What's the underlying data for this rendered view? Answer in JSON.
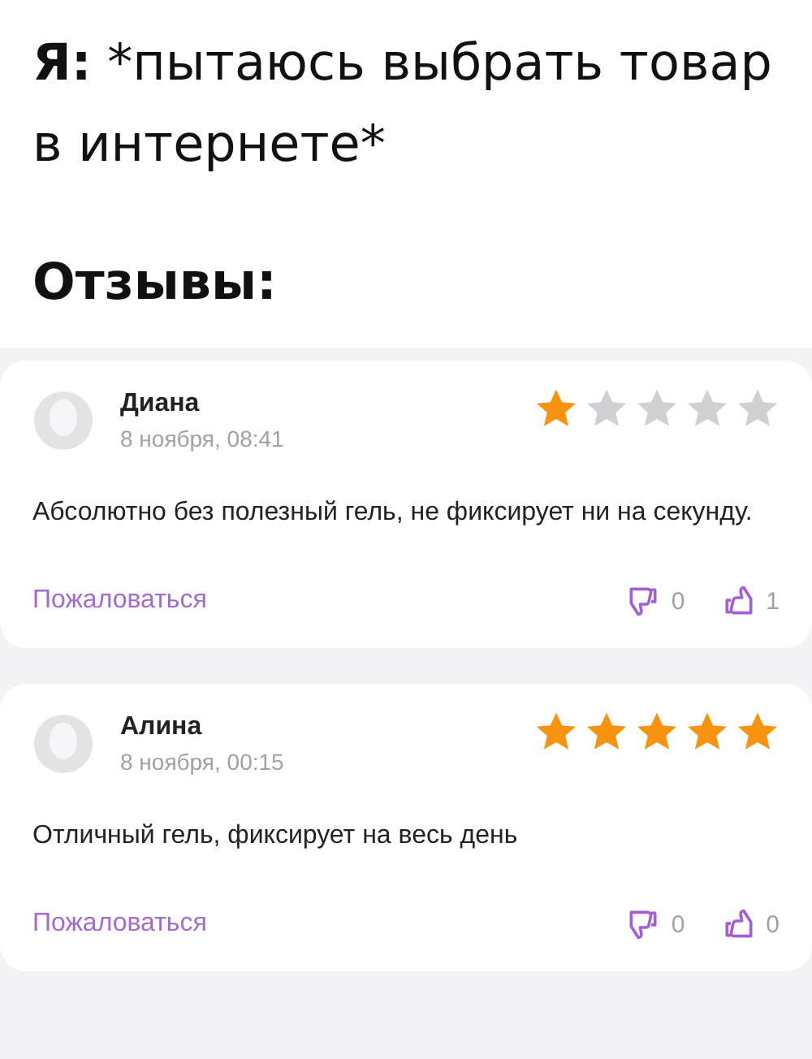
{
  "caption": {
    "speaker": "Я:",
    "text": "*пытаюсь выбрать товар в интернете*"
  },
  "section_title": "Отзывы:",
  "reviews": [
    {
      "author": "Диана",
      "date": "8 ноября, 08:41",
      "stars": 1,
      "text": "Абсолютно без полезный гель, не фиксирует ни на секунду.",
      "report": "Пожаловаться",
      "dislikes": "0",
      "likes": "1"
    },
    {
      "author": "Алина",
      "date": "8 ноября, 00:15",
      "stars": 5,
      "text": "Отличный гель, фиксирует на весь день",
      "report": "Пожаловаться",
      "dislikes": "0",
      "likes": "0"
    }
  ]
}
